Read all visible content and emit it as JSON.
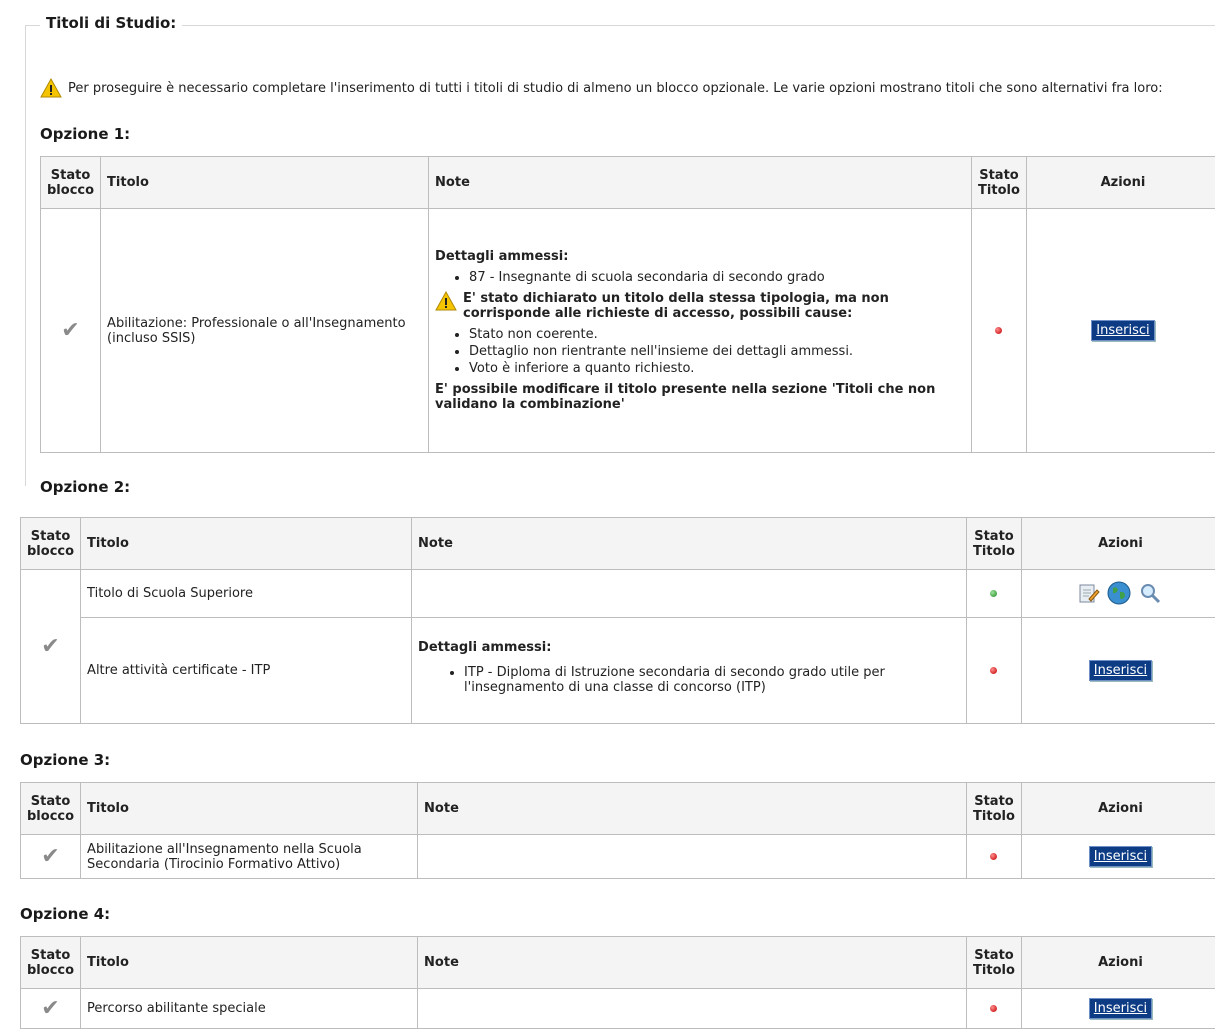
{
  "section_title": "Titoli di Studio:",
  "warning_text": "Per proseguire è necessario completare l'inserimento di tutti i titoli di studio di almeno un blocco opzionale. Le varie opzioni mostrano titoli che sono alternativi fra loro:",
  "headers": {
    "stato_blocco_1": "Stato",
    "stato_blocco_2": "blocco",
    "titolo": "Titolo",
    "note": "Note",
    "stato_titolo_1": "Stato",
    "stato_titolo_2": "Titolo",
    "azioni": "Azioni"
  },
  "button_label": "Inserisci",
  "options": [
    {
      "label": "Opzione 1:",
      "rows": [
        {
          "titolo": "Abilitazione: Professionale o all'Insegnamento (incluso SSIS)",
          "note_title": "Dettagli ammessi:",
          "note_items": [
            "87 - Insegnante di scuola secondaria di secondo grado"
          ],
          "note_warning": "E' stato dichiarato un titolo della stessa tipologia, ma non corrisponde alle richieste di accesso, possibili cause:",
          "note_causes": [
            "Stato non coerente.",
            "Dettaglio non rientrante nell'insieme dei dettagli ammessi.",
            "Voto è inferiore a quanto richiesto."
          ],
          "note_footer": "E' possibile modificare il titolo presente nella sezione 'Titoli che non validano la combinazione'",
          "stato": "red"
        }
      ]
    },
    {
      "label": "Opzione 2:",
      "rows": [
        {
          "titolo": "Titolo di Scuola Superiore",
          "stato": "green"
        },
        {
          "titolo": "Altre attività certificate - ITP",
          "note_title": "Dettagli ammessi:",
          "note_items": [
            "ITP - Diploma di Istruzione secondaria di secondo grado utile per l'insegnamento di una classe di concorso (ITP)"
          ],
          "stato": "red"
        }
      ]
    },
    {
      "label": "Opzione 3:",
      "rows": [
        {
          "titolo": "Abilitazione all'Insegnamento nella Scuola Secondaria (Tirocinio Formativo Attivo)",
          "stato": "red"
        }
      ]
    },
    {
      "label": "Opzione 4:",
      "rows": [
        {
          "titolo": "Percorso abilitante speciale",
          "stato": "red"
        }
      ]
    }
  ],
  "icons": {
    "stato_blocco": "checkmark-icon",
    "warning": "warning-triangle-icon",
    "edit": "edit-icon",
    "globe": "globe-icon",
    "search": "magnifier-icon"
  }
}
